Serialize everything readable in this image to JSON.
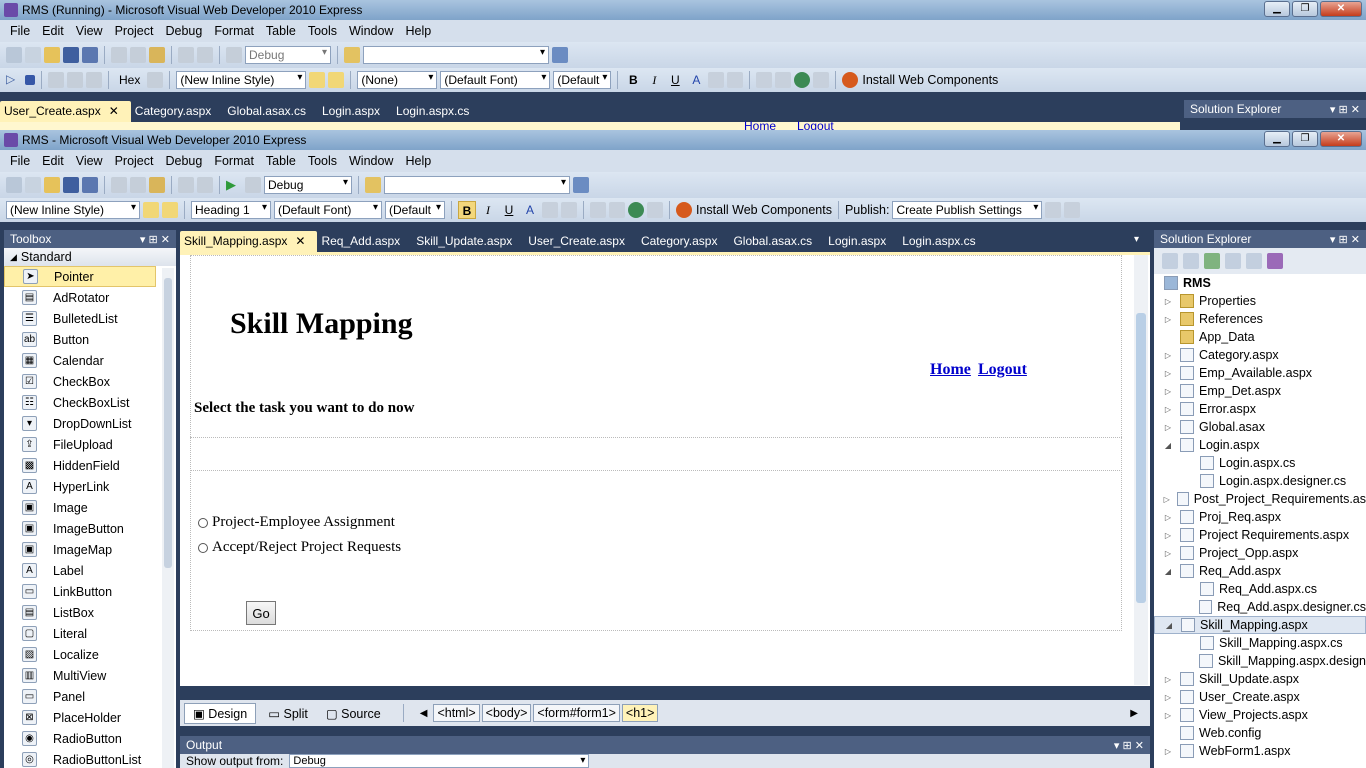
{
  "outer_window": {
    "title": "RMS (Running) - Microsoft Visual Web Developer 2010 Express"
  },
  "outer_menu": [
    "File",
    "Edit",
    "View",
    "Project",
    "Debug",
    "Format",
    "Table",
    "Tools",
    "Window",
    "Help"
  ],
  "outer_toolbar": {
    "config": "Debug",
    "style": "(New Inline Style)",
    "hex": "Hex",
    "block": "(None)",
    "font": "(Default Font)",
    "size": "(Default",
    "install": "Install Web Components"
  },
  "outer_tabs": [
    "User_Create.aspx",
    "Category.aspx",
    "Global.asax.cs",
    "Login.aspx",
    "Login.aspx.cs"
  ],
  "outer_solution": "Solution Explorer",
  "outer_peek": {
    "home": "Home",
    "logout": "Logout"
  },
  "inner_window": {
    "title": "RMS - Microsoft Visual Web Developer 2010 Express"
  },
  "inner_menu": [
    "File",
    "Edit",
    "View",
    "Project",
    "Debug",
    "Format",
    "Table",
    "Tools",
    "Window",
    "Help"
  ],
  "inner_toolbar": {
    "config": "Debug",
    "style": "(New Inline Style)",
    "block": "Heading 1",
    "font": "(Default Font)",
    "size": "(Default",
    "install": "Install Web Components",
    "publish_label": "Publish:",
    "publish_value": "Create Publish Settings"
  },
  "toolbox": {
    "title": "Toolbox",
    "group": "Standard",
    "items": [
      "Pointer",
      "AdRotator",
      "BulletedList",
      "Button",
      "Calendar",
      "CheckBox",
      "CheckBoxList",
      "DropDownList",
      "FileUpload",
      "HiddenField",
      "HyperLink",
      "Image",
      "ImageButton",
      "ImageMap",
      "Label",
      "LinkButton",
      "ListBox",
      "Literal",
      "Localize",
      "MultiView",
      "Panel",
      "PlaceHolder",
      "RadioButton",
      "RadioButtonList"
    ]
  },
  "doc_tabs": [
    "Skill_Mapping.aspx",
    "Req_Add.aspx",
    "Skill_Update.aspx",
    "User_Create.aspx",
    "Category.aspx",
    "Global.asax.cs",
    "Login.aspx",
    "Login.aspx.cs"
  ],
  "design": {
    "heading": "Skill Mapping",
    "home": "Home",
    "logout": "Logout",
    "prompt": "Select the task you want to do now",
    "options": [
      "Project-Employee Assignment",
      "Accept/Reject Project Requests"
    ],
    "go": "Go"
  },
  "view_tabs": {
    "design": "Design",
    "split": "Split",
    "source": "Source"
  },
  "breadcrumb": [
    "<html>",
    "<body>",
    "<form#form1>",
    "<h1>"
  ],
  "output": {
    "title": "Output",
    "show_label": "Show output from:",
    "show_value": "Debug"
  },
  "solution": {
    "title": "Solution Explorer",
    "root": "RMS",
    "items": [
      {
        "label": "Properties",
        "indent": 0,
        "exp": "▷",
        "kind": "folder"
      },
      {
        "label": "References",
        "indent": 0,
        "exp": "▷",
        "kind": "folder"
      },
      {
        "label": "App_Data",
        "indent": 0,
        "exp": "",
        "kind": "folder"
      },
      {
        "label": "Category.aspx",
        "indent": 0,
        "exp": "▷",
        "kind": "file"
      },
      {
        "label": "Emp_Available.aspx",
        "indent": 0,
        "exp": "▷",
        "kind": "file"
      },
      {
        "label": "Emp_Det.aspx",
        "indent": 0,
        "exp": "▷",
        "kind": "file"
      },
      {
        "label": "Error.aspx",
        "indent": 0,
        "exp": "▷",
        "kind": "file"
      },
      {
        "label": "Global.asax",
        "indent": 0,
        "exp": "▷",
        "kind": "file"
      },
      {
        "label": "Login.aspx",
        "indent": 0,
        "exp": "◢",
        "kind": "file"
      },
      {
        "label": "Login.aspx.cs",
        "indent": 1,
        "exp": "",
        "kind": "file"
      },
      {
        "label": "Login.aspx.designer.cs",
        "indent": 1,
        "exp": "",
        "kind": "file"
      },
      {
        "label": "Post_Project_Requirements.as",
        "indent": 0,
        "exp": "▷",
        "kind": "file"
      },
      {
        "label": "Proj_Req.aspx",
        "indent": 0,
        "exp": "▷",
        "kind": "file"
      },
      {
        "label": "Project Requirements.aspx",
        "indent": 0,
        "exp": "▷",
        "kind": "file"
      },
      {
        "label": "Project_Opp.aspx",
        "indent": 0,
        "exp": "▷",
        "kind": "file"
      },
      {
        "label": "Req_Add.aspx",
        "indent": 0,
        "exp": "◢",
        "kind": "file"
      },
      {
        "label": "Req_Add.aspx.cs",
        "indent": 1,
        "exp": "",
        "kind": "file"
      },
      {
        "label": "Req_Add.aspx.designer.cs",
        "indent": 1,
        "exp": "",
        "kind": "file"
      },
      {
        "label": "Skill_Mapping.aspx",
        "indent": 0,
        "exp": "◢",
        "kind": "file",
        "selected": true
      },
      {
        "label": "Skill_Mapping.aspx.cs",
        "indent": 1,
        "exp": "",
        "kind": "file"
      },
      {
        "label": "Skill_Mapping.aspx.design",
        "indent": 1,
        "exp": "",
        "kind": "file"
      },
      {
        "label": "Skill_Update.aspx",
        "indent": 0,
        "exp": "▷",
        "kind": "file"
      },
      {
        "label": "User_Create.aspx",
        "indent": 0,
        "exp": "▷",
        "kind": "file"
      },
      {
        "label": "View_Projects.aspx",
        "indent": 0,
        "exp": "▷",
        "kind": "file"
      },
      {
        "label": "Web.config",
        "indent": 0,
        "exp": "",
        "kind": "file"
      },
      {
        "label": "WebForm1.aspx",
        "indent": 0,
        "exp": "▷",
        "kind": "file"
      }
    ]
  }
}
